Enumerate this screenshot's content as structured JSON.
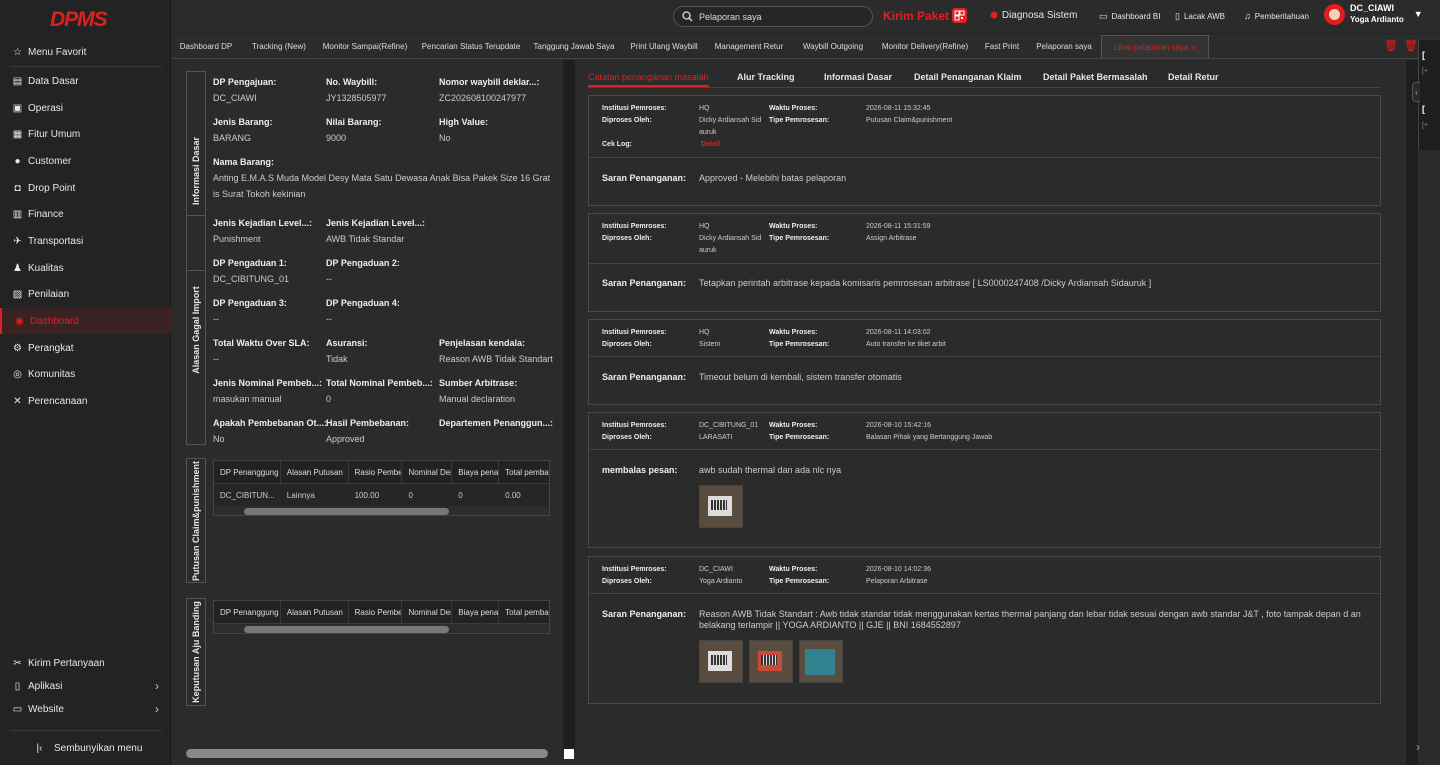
{
  "app": {
    "logo": "DPMS"
  },
  "sidebar": {
    "items": [
      {
        "label": "Menu Favorit",
        "icon": "star-icon"
      },
      {
        "label": "Data Dasar",
        "icon": "database-icon"
      },
      {
        "label": "Operasi",
        "icon": "operation-icon"
      },
      {
        "label": "Fitur Umum",
        "icon": "briefcase-icon"
      },
      {
        "label": "Customer",
        "icon": "user-icon"
      },
      {
        "label": "Drop Point",
        "icon": "droppoint-icon"
      },
      {
        "label": "Finance",
        "icon": "finance-icon"
      },
      {
        "label": "Transportasi",
        "icon": "plane-icon"
      },
      {
        "label": "Kualitas",
        "icon": "quality-icon"
      },
      {
        "label": "Penilaian",
        "icon": "assessment-icon"
      },
      {
        "label": "Dashboard",
        "icon": "dashboard-icon",
        "active": true
      },
      {
        "label": "Perangkat",
        "icon": "device-icon"
      },
      {
        "label": "Komunitas",
        "icon": "community-icon"
      },
      {
        "label": "Perencanaan",
        "icon": "planning-icon"
      }
    ],
    "bottom": [
      {
        "label": "Kirim Pertanyaan",
        "icon": "question-icon"
      },
      {
        "label": "Aplikasi",
        "icon": "phone-icon"
      },
      {
        "label": "Website",
        "icon": "monitor-icon"
      }
    ],
    "hide_menu": "Sembunyikan menu"
  },
  "header": {
    "search_value": "Pelaporan saya",
    "kirim_paket": "Kirim Paket",
    "diagnosa": "Diagnosa Sistem",
    "dashboard_bi": "Dashboard BI",
    "lacak_awb": "Lacak AWB",
    "pemberitahuan": "Pemberitahuan",
    "user_org": "DC_CIAWI",
    "user_name": "Yoga Ardianto"
  },
  "tabs": [
    {
      "label": "Dashboard DP"
    },
    {
      "label": "Tracking (New)"
    },
    {
      "label": "Monitor Sampai(Refine)"
    },
    {
      "label": "Pencarian Status Terupdate"
    },
    {
      "label": "Tanggung Jawab Saya"
    },
    {
      "label": "Print Ulang Waybill"
    },
    {
      "label": "Management Retur"
    },
    {
      "label": "Waybill Outgoing"
    },
    {
      "label": "Monitor Delivery(Refine)"
    },
    {
      "label": "Fast Print"
    },
    {
      "label": "Pelaporan saya"
    },
    {
      "label": "Lihat pelaporan saya",
      "active": true
    }
  ],
  "info_dasar": {
    "section_label": "Informasi Dasar",
    "dp_pengajuan_l": "DP Pengajuan:",
    "dp_pengajuan_v": "DC_CIAWI",
    "waybill_l": "No. Waybill:",
    "waybill_v": "JY1328505977",
    "nomor_deklar_l": "Nomor waybill deklar...:",
    "nomor_deklar_v": "ZC202608100247977",
    "jenis_barang_l": "Jenis Barang:",
    "jenis_barang_v": "BARANG",
    "nilai_barang_l": "Nilai Barang:",
    "nilai_barang_v": "9000",
    "high_value_l": "High Value:",
    "high_value_v": "No",
    "nama_barang_l": "Nama Barang:",
    "nama_barang_v": "Anting E.M.A.S Muda Model Desy Mata Satu Dewasa Anak Bisa Pakek Size 16 Grat is Surat Tokoh kekinian"
  },
  "alasan": {
    "section_label": "Alasan Gagal Import",
    "jk1_l": "Jenis Kejadian Level...:",
    "jk1_v": "Punishment",
    "jk2_l": "Jenis Kejadian Level...:",
    "jk2_v": "AWB Tidak Standar",
    "dp1_l": "DP Pengaduan 1:",
    "dp1_v": "DC_CIBITUNG_01",
    "dp2_l": "DP Pengaduan 2:",
    "dp2_v": "--",
    "dp3_l": "DP Pengaduan 3:",
    "dp3_v": "--",
    "dp4_l": "DP Pengaduan 4:",
    "dp4_v": "--",
    "sla_l": "Total Waktu Over SLA:",
    "sla_v": "--",
    "asuransi_l": "Asuransi:",
    "asuransi_v": "Tidak",
    "penjelasan_l": "Penjelasan kendala:",
    "penjelasan_v": "Reason AWB Tidak Standart",
    "jnp_l": "Jenis Nominal Pembeb...:",
    "jnp_v": "masukan manual",
    "tnp_l": "Total Nominal Pembeb...:",
    "tnp_v": "0",
    "sumber_l": "Sumber Arbitrase:",
    "sumber_v": "Manual declaration",
    "apakah_l": "Apakah Pembebanan Ot...:",
    "apakah_v": "No",
    "hasil_l": "Hasil Pembebanan:",
    "hasil_v": "Approved",
    "dept_l": "Departemen Penanggun...:",
    "dept_v": ""
  },
  "putusan": {
    "section_label": "Putusan Claim&punishment",
    "headers": [
      "DP Penanggung ...",
      "Alasan Putusan",
      "Rasio Pembeba...",
      "Nominal Denda",
      "Biaya penang...",
      "Total pembaya..."
    ],
    "row": [
      "DC_CIBITUN...",
      "Lainnya",
      "100.00",
      "0",
      "0",
      "0.00"
    ]
  },
  "banding": {
    "section_label": "Keputusan Aju Banding",
    "headers": [
      "DP Penanggung ...",
      "Alasan Putusan",
      "Rasio Pembeba...",
      "Nominal Denda",
      "Biaya penang...",
      "Total pembaya..."
    ]
  },
  "rtabs": [
    {
      "label": "Catatan penanganan masalah",
      "active": true
    },
    {
      "label": "Alur Tracking"
    },
    {
      "label": "Informasi Dasar"
    },
    {
      "label": "Detail Penanganan Klaim"
    },
    {
      "label": "Detail Paket Bermasalah"
    },
    {
      "label": "Detail Retur"
    }
  ],
  "labels": {
    "institusi": "Institusi Pemroses:",
    "diproses": "Diproses Oleh:",
    "waktu": "Waktu Proses:",
    "tipe": "Tipe Pemrosesan:",
    "ceklog": "Cek Log:",
    "detail": "Detail",
    "saran": "Saran Penanganan:",
    "membalas": "membalas pesan:"
  },
  "records": [
    {
      "institusi": "HQ",
      "oleh": "Dicky Ardiansah Sidauruk",
      "oleh1": "Dicky Ardiansah Sid",
      "oleh2": "auruk",
      "waktu": "2026-08-11 15:32:45",
      "tipe": "Putusan Claim&punishment",
      "saran": "Approved - Melebihi batas pelaporan"
    },
    {
      "institusi": "HQ",
      "oleh1": "Dicky Ardiansah Sid",
      "oleh2": "auruk",
      "waktu": "2026-08-11 15:31:59",
      "tipe": "Assign Arbitrase",
      "saran": "Tetapkan perintah arbitrase kepada komisaris pemrosesan arbitrase [ LS0000247408 /Dicky Ardiansah Sidauruk ]"
    },
    {
      "institusi": "HQ",
      "oleh1": "Sistem",
      "waktu": "2026-08-11 14:03:02",
      "tipe": "Auto transfer ke tiket arbit",
      "saran": "Timeout belum di kembali, sistem transfer otomatis"
    },
    {
      "institusi": "DC_CIBITUNG_01",
      "oleh1": "LARASATI",
      "waktu": "2026-08-10 15:42:16",
      "tipe": "Balasan Pihak yang Bertanggung Jawab",
      "saran": "awb sudah thermal dan ada nlc nya"
    },
    {
      "institusi": "DC_CIAWI",
      "oleh1": "Yoga Ardianto",
      "waktu": "2026-08-10 14:02:36",
      "tipe": "Pelaporan Arbitrase",
      "saran": "Reason AWB Tidak Standart : Awb tidak standar tidak menggunakan kertas thermal panjang dan lebar tidak sesuai dengan awb standar J&T , foto tampak depan d an belakang terlampir || YOGA ARDIANTO || GJE || BNI 1684552897"
    }
  ],
  "drawer": {
    "b1": "[",
    "g1": "[+",
    "b2": "[",
    "g2": "[+"
  },
  "colors": {
    "accent": "#e02020",
    "bg": "#2b2b2b",
    "sidebar": "#232323"
  }
}
